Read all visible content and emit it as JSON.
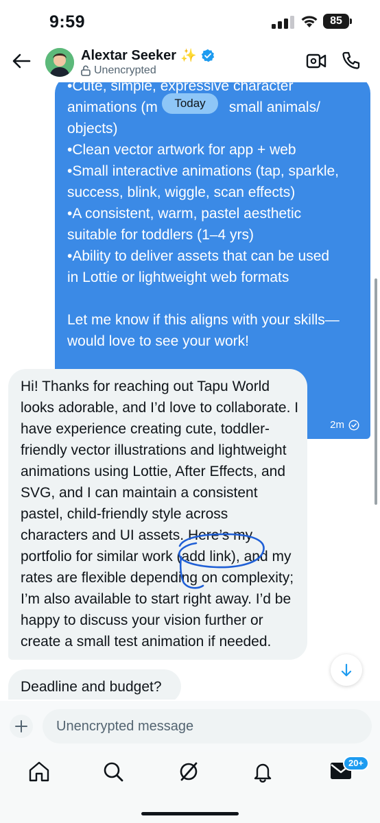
{
  "status": {
    "time": "9:59",
    "battery": "85"
  },
  "header": {
    "contact_name": "Alextar Seeker",
    "sparkle": "✨",
    "encryption_status": "Unencrypted"
  },
  "chat": {
    "date_divider": "Today",
    "sent_lines": [
      "•Cute, simple, expressive character",
      "animations (m",
      "objects)",
      "•Clean vector artwork for app + web",
      "•Small interactive animations (tap, sparkle,",
      "success, blink, wiggle, scan effects)",
      "•A consistent, warm, pastel aesthetic",
      "suitable for toddlers (1–4 yrs)",
      "•Ability to deliver assets that can be used",
      "in Lottie or lightweight web formats",
      "",
      "Let me know if this aligns with your skills—",
      "would love to see your work!"
    ],
    "sent_line2_tail": "small animals/",
    "sent_time": "2m",
    "received_lines": [
      "Hi! Thanks for reaching out Tapu World",
      "looks adorable, and I’d love to collaborate. I",
      "have experience creating cute, toddler-",
      "friendly vector illustrations and lightweight",
      "animations using Lottie, After Effects, and",
      "SVG, and I can maintain a consistent",
      "pastel, child-friendly style across",
      "characters and UI assets. Here’s my",
      "portfolio for similar work (add link), and my",
      "rates are flexible depending on complexity;",
      "I’m also available to start right away. I’d be",
      "happy to discuss your vision further or",
      "create a small test animation if needed."
    ],
    "received_2": "Deadline and budget?"
  },
  "composer": {
    "placeholder": "Unencrypted message"
  },
  "tabbar": {
    "icons": [
      "home-icon",
      "search-icon",
      "grok-icon",
      "notifications-icon",
      "messages-icon"
    ],
    "messages_badge": "20+"
  },
  "colors": {
    "sent_bubble": "#3b8ae6",
    "received_bubble": "#eff3f4",
    "accent": "#1d9bf0",
    "annotation": "#1f5fd6"
  }
}
